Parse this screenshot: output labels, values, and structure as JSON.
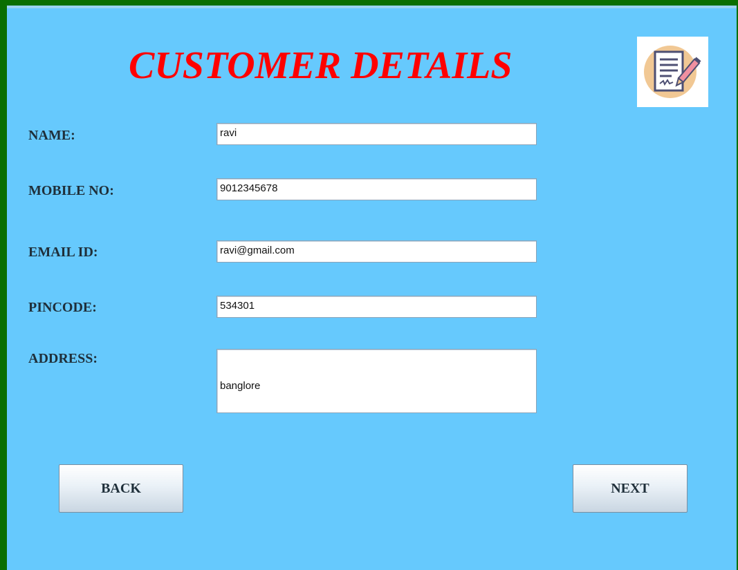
{
  "header": {
    "title": "CUSTOMER DETAILS",
    "logo_icon": "document-signature-icon",
    "title_color": "#ff0000"
  },
  "form": {
    "name_label": "NAME:",
    "name_value": "ravi",
    "mobile_label": "MOBILE NO:",
    "mobile_value": "9012345678",
    "email_label": "EMAIL ID:",
    "email_value": "ravi@gmail.com",
    "pincode_label": "PINCODE:",
    "pincode_value": "534301",
    "address_label": "ADDRESS:",
    "address_value": "banglore"
  },
  "buttons": {
    "back_label": "BACK",
    "next_label": "NEXT"
  },
  "colors": {
    "background": "#66c9fd",
    "frame": "#0a6e00"
  }
}
